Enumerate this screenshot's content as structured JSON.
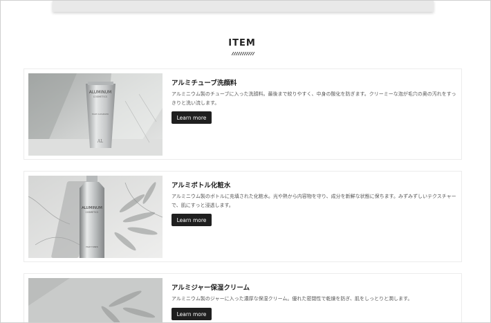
{
  "section": {
    "title": "ITEM"
  },
  "items": [
    {
      "name": "アルミチューブ洗顔料",
      "description": "アルミニウム製のチューブに入った洗顔料。最後まで絞りやすく、中身の酸化を防ぎます。クリーミーな泡が毛穴の奥の汚れをすっきりと洗い流します。",
      "button": "Learn more",
      "product_brand": "ALUMINUM",
      "product_sub": "COSMETICS",
      "product_type": "FACE CLEANSER"
    },
    {
      "name": "アルミボトル化粧水",
      "description": "アルミニウム製のボトルに充填された化粧水。光や熱から内容物を守り、成分を新鮮な状態に保ちます。みずみずしいテクスチャーで、肌にすっと浸透します。",
      "button": "Learn more",
      "product_brand": "ALUMINUM",
      "product_sub": "COSMETICS",
      "product_type": "FACE TONER"
    },
    {
      "name": "アルミジャー保湿クリーム",
      "description": "アルミニウム製のジャーに入った濃厚な保湿クリーム。優れた密閉性で乾燥を防ぎ、肌をしっとりと潤します。",
      "button": "Learn more"
    }
  ]
}
